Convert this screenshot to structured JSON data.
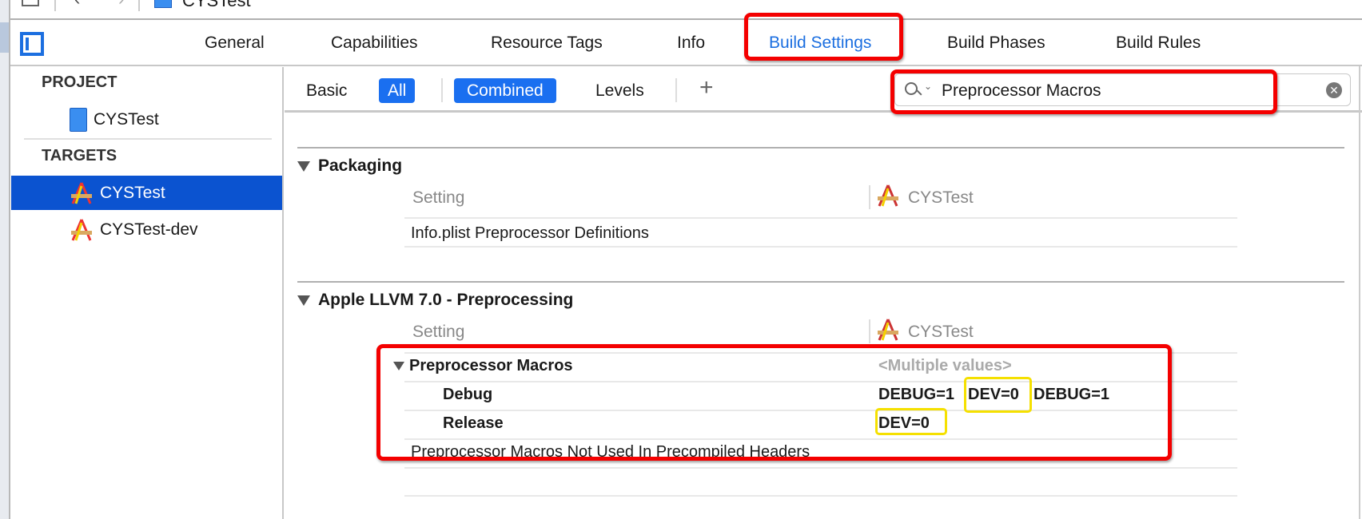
{
  "window": {
    "title": "CYSTest"
  },
  "tabs": [
    {
      "label": "General"
    },
    {
      "label": "Capabilities"
    },
    {
      "label": "Resource Tags"
    },
    {
      "label": "Info"
    },
    {
      "label": "Build Settings",
      "active": true
    },
    {
      "label": "Build Phases"
    },
    {
      "label": "Build Rules"
    }
  ],
  "sidebar": {
    "project_header": "PROJECT",
    "project_items": [
      {
        "label": "CYSTest",
        "icon": "project-file-icon"
      }
    ],
    "targets_header": "TARGETS",
    "target_items": [
      {
        "label": "CYSTest",
        "icon": "app-target-icon",
        "selected": true
      },
      {
        "label": "CYSTest-dev",
        "icon": "app-target-icon"
      }
    ]
  },
  "filterbar": {
    "basic": "Basic",
    "all": "All",
    "combined": "Combined",
    "levels": "Levels",
    "add": "+"
  },
  "search": {
    "value": "Preprocessor Macros",
    "icon": "search-icon"
  },
  "sections": [
    {
      "title": "Packaging",
      "col_setting": "Setting",
      "col_target": "CYSTest",
      "rows": [
        {
          "name": "Info.plist Preprocessor Definitions"
        }
      ]
    },
    {
      "title": "Apple LLVM 7.0 - Preprocessing",
      "col_setting": "Setting",
      "col_target": "CYSTest",
      "macros": {
        "name": "Preprocessor Macros",
        "value": "<Multiple values>",
        "debug": {
          "label": "Debug",
          "v1": "DEBUG=1",
          "v2": "DEV=0",
          "v3": "DEBUG=1"
        },
        "release": {
          "label": "Release",
          "v1": "DEV=0"
        }
      },
      "last_row": "Preprocessor Macros Not Used In Precompiled Headers"
    }
  ],
  "colors": {
    "accent": "#1a6ff0",
    "selection": "#0b53d0",
    "annotation_red": "#f40000",
    "annotation_yellow": "#f5e000"
  }
}
